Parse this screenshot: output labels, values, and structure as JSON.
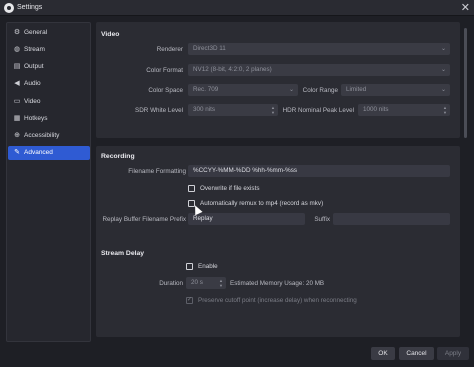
{
  "window": {
    "title": "Settings",
    "close_glyph": "✕"
  },
  "sidebar": {
    "items": [
      {
        "label": "General",
        "icon": "gear-icon"
      },
      {
        "label": "Stream",
        "icon": "globe-icon"
      },
      {
        "label": "Output",
        "icon": "output-icon"
      },
      {
        "label": "Audio",
        "icon": "speaker-icon"
      },
      {
        "label": "Video",
        "icon": "monitor-icon"
      },
      {
        "label": "Hotkeys",
        "icon": "keyboard-icon"
      },
      {
        "label": "Accessibility",
        "icon": "accessibility-icon"
      },
      {
        "label": "Advanced",
        "icon": "wrench-icon",
        "active": true
      }
    ]
  },
  "video": {
    "title": "Video",
    "renderer_label": "Renderer",
    "renderer_value": "Direct3D 11",
    "color_format_label": "Color Format",
    "color_format_value": "NV12 (8-bit, 4:2:0, 2 planes)",
    "color_space_label": "Color Space",
    "color_space_value": "Rec. 709",
    "color_range_label": "Color Range",
    "color_range_value": "Limited",
    "sdr_label": "SDR White Level",
    "sdr_value": "300 nits",
    "hdr_label": "HDR Nominal Peak Level",
    "hdr_value": "1000 nits"
  },
  "recording": {
    "title": "Recording",
    "filename_label": "Filename Formatting",
    "filename_value": "%CCYY-%MM-%DD %hh-%mm-%ss",
    "overwrite_label": "Overwrite if file exists",
    "overwrite_checked": false,
    "remux_label": "Automatically remux to mp4 (record as mkv)",
    "remux_checked": false,
    "replay_prefix_label": "Replay Buffer Filename Prefix",
    "replay_prefix_value": "Replay",
    "suffix_label": "Suffix",
    "suffix_value": ""
  },
  "stream_delay": {
    "title": "Stream Delay",
    "enable_label": "Enable",
    "enable_checked": false,
    "duration_label": "Duration",
    "duration_value": "20 s",
    "memory_text": "Estimated Memory Usage: 20 MB",
    "preserve_label": "Preserve cutoff point (increase delay) when reconnecting",
    "preserve_checked": true
  },
  "footer": {
    "ok_label": "OK",
    "cancel_label": "Cancel",
    "apply_label": "Apply"
  },
  "colors": {
    "accent": "#2f5bd3",
    "background": "#1e1f25",
    "panel": "#2b2c33",
    "field": "#3a3b44"
  }
}
